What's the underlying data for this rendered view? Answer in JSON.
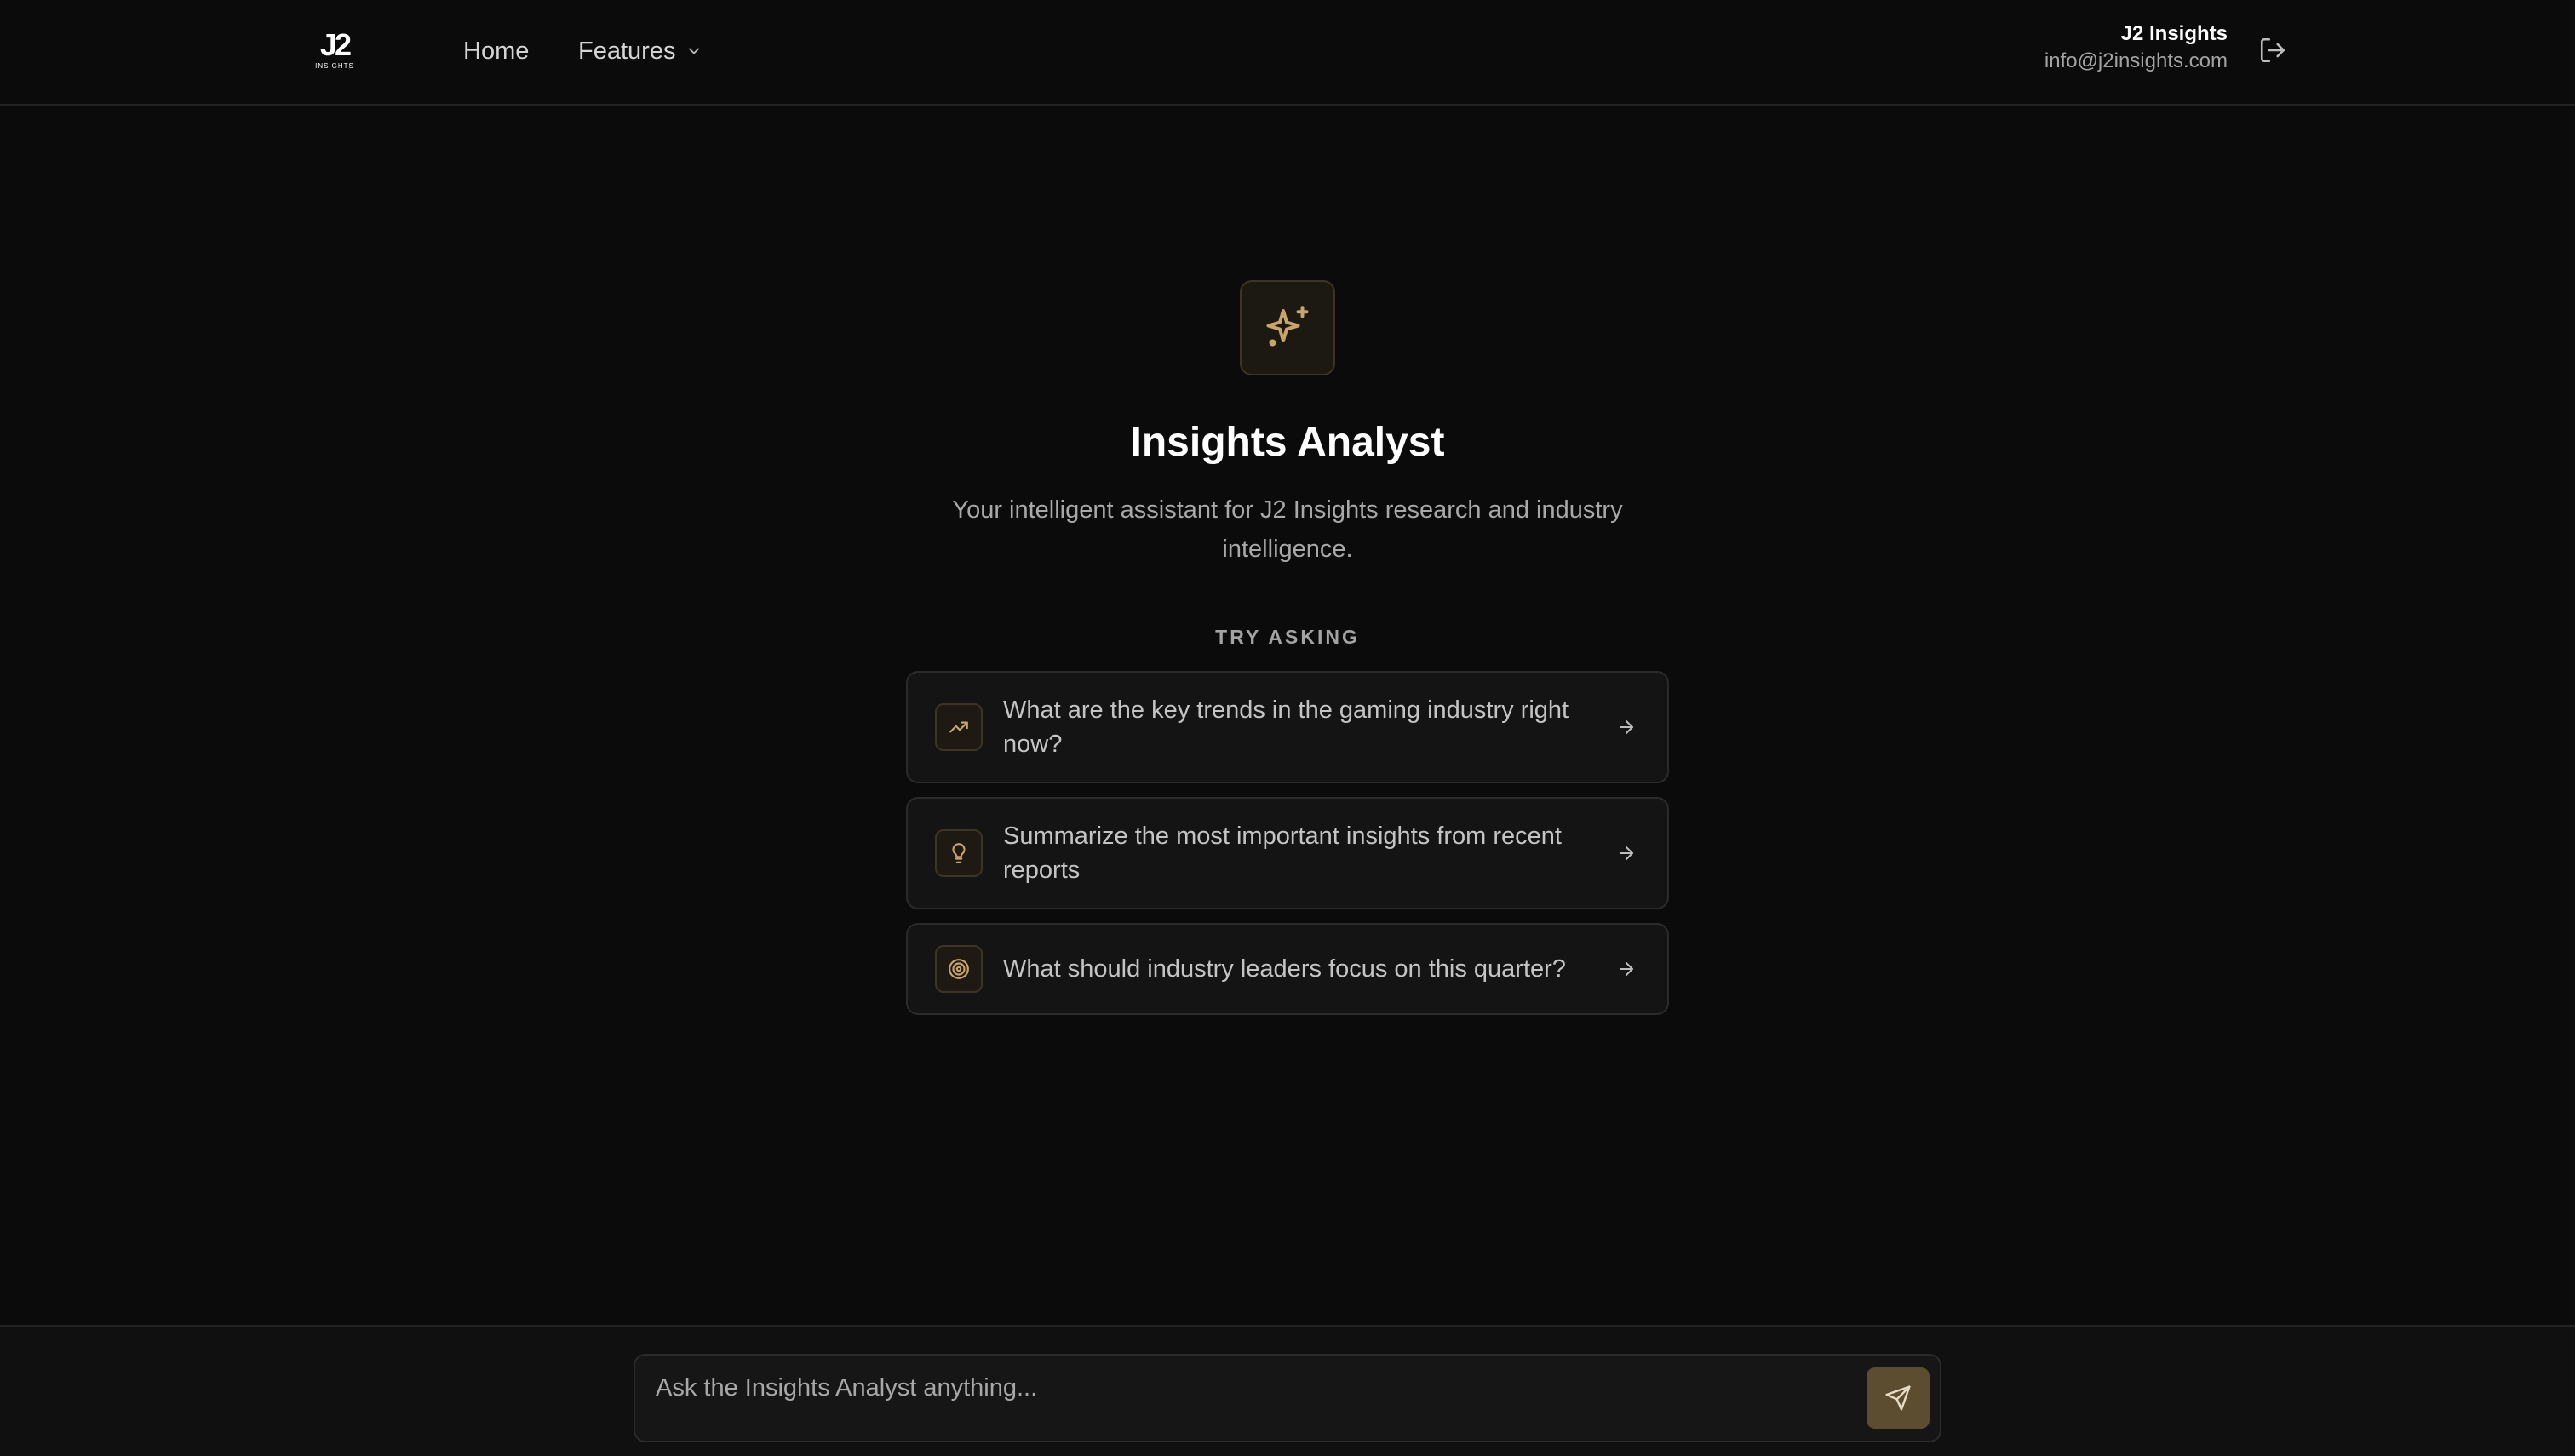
{
  "colors": {
    "background": "#0b0b0b",
    "accent": "#c9a56a",
    "card": "#141414",
    "border": "#2b2b2b"
  },
  "header": {
    "logo": {
      "mark": "J2",
      "sub": "INSIGHTS"
    },
    "nav": {
      "home": "Home",
      "features": "Features"
    },
    "user": {
      "name": "J2 Insights",
      "email": "info@j2insights.com"
    },
    "icons": {
      "features": "chevron-down-icon",
      "logout": "logout-icon"
    }
  },
  "hero": {
    "icon": "sparkles-icon",
    "title": "Insights Analyst",
    "subtitle": "Your intelligent assistant for J2 Insights research and industry intelligence."
  },
  "suggestions": {
    "label": "TRY ASKING",
    "items": [
      {
        "icon": "trending-up-icon",
        "text": "What are the key trends in the gaming industry right now?"
      },
      {
        "icon": "lightbulb-icon",
        "text": "Summarize the most important insights from recent reports"
      },
      {
        "icon": "target-icon",
        "text": "What should industry leaders focus on this quarter?"
      }
    ]
  },
  "composer": {
    "placeholder": "Ask the Insights Analyst anything...",
    "send_icon": "send-icon"
  }
}
